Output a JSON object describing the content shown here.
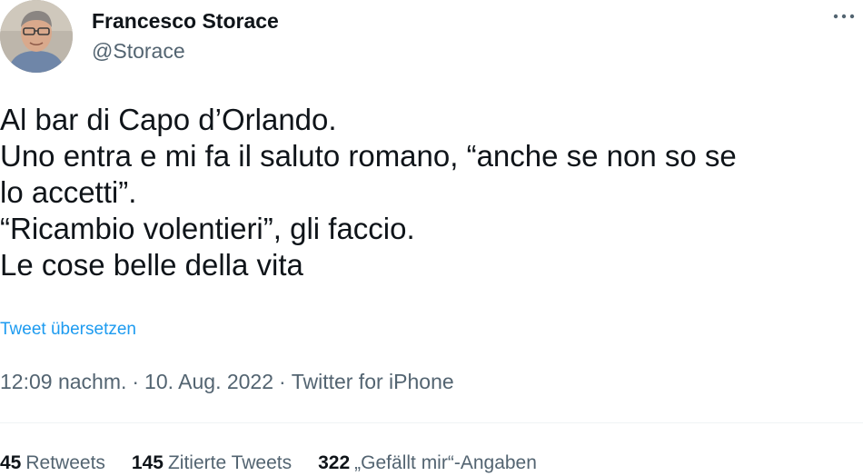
{
  "author": {
    "display_name": "Francesco Storace",
    "handle": "@Storace"
  },
  "tweet": {
    "lines": [
      "Al bar di Capo d’Orlando.",
      "Uno entra e mi fa il saluto romano, “anche se non so se",
      "lo accetti”.",
      "“Ricambio volentieri”, gli faccio.",
      "Le cose belle della vita"
    ],
    "translate_label": "Tweet übersetzen"
  },
  "meta": {
    "time": "12:09 nachm.",
    "separator": "·",
    "date": "10. Aug. 2022",
    "source": "Twitter for iPhone"
  },
  "stats": {
    "retweets_count": "45",
    "retweets_label": "Retweets",
    "quotes_count": "145",
    "quotes_label": "Zitierte Tweets",
    "likes_count": "322",
    "likes_label": "„Gefällt mir“-Angaben"
  },
  "icons": {
    "more": "more-horizontal-icon"
  }
}
